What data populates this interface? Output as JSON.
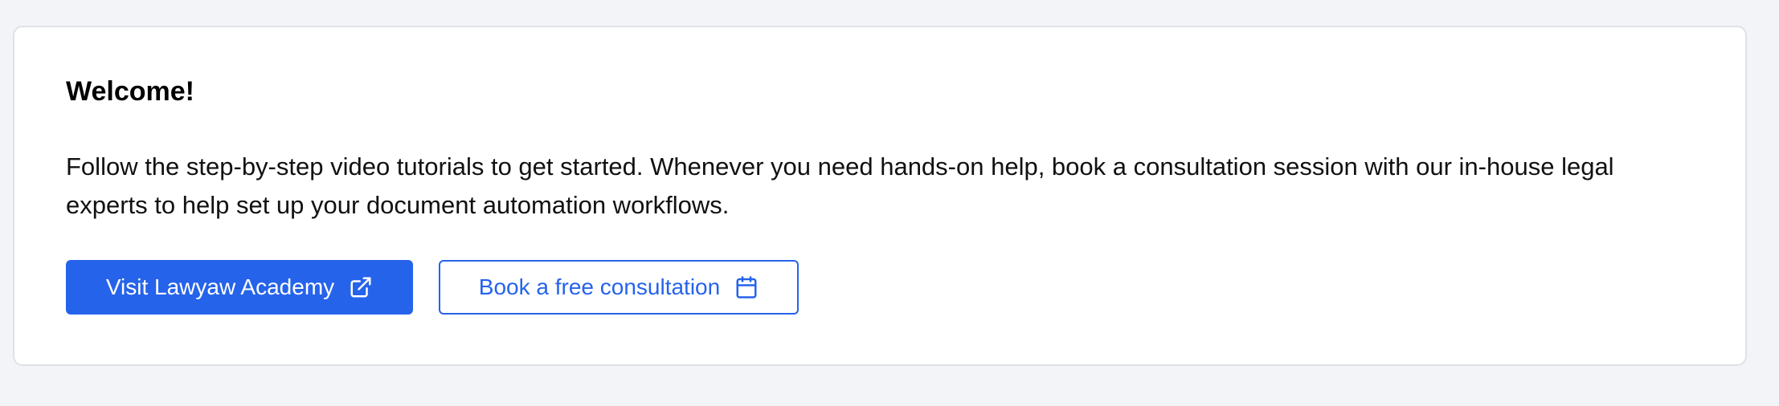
{
  "welcome_card": {
    "title": "Welcome!",
    "description": "Follow the step-by-step video tutorials to get started. Whenever you need hands-on help, book a consultation session with our in-house legal experts to help set up your document automation workflows.",
    "primary_button": {
      "label": "Visit Lawyaw Academy",
      "icon": "external-link-icon"
    },
    "secondary_button": {
      "label": "Book a free consultation",
      "icon": "calendar-icon"
    }
  },
  "colors": {
    "page_background": "#f3f4f7",
    "card_background": "#ffffff",
    "card_border": "#dfe1e6",
    "accent": "#2563eb",
    "text": "#111111"
  }
}
